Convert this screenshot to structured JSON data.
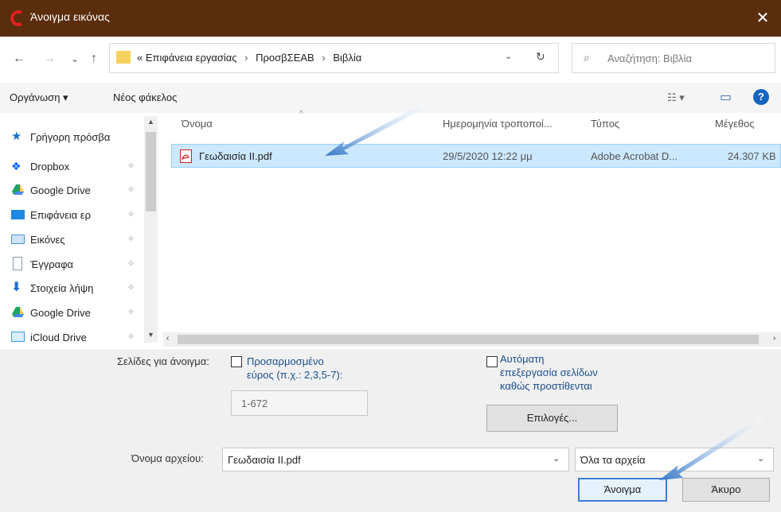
{
  "window": {
    "title": "Άνοιγμα εικόνας",
    "close_glyph": "✕"
  },
  "nav": {
    "back": "←",
    "forward": "→",
    "recent": "⌄",
    "up": "↑",
    "breadcrumb_prefix": "«",
    "breadcrumbs": [
      "Επιφάνεια εργασίας",
      "ΠροσβΣΕΑΒ",
      "Βιβλία"
    ],
    "separator": "›",
    "dropdown": "⌄",
    "refresh": "↻"
  },
  "search": {
    "placeholder": "Αναζήτηση: Βιβλία"
  },
  "toolbar": {
    "organize": "Οργάνωση ▾",
    "new_folder": "Νέος φάκελος",
    "view": "☷ ▾",
    "pane": "▭",
    "help": "?"
  },
  "sidebar": {
    "items": [
      {
        "label": "Γρήγορη πρόσβα",
        "icon": "star-icon",
        "color": "#1a73c8",
        "pinned": false
      },
      {
        "label": "Dropbox",
        "icon": "dropbox-icon",
        "color": "#0061fe",
        "pinned": true
      },
      {
        "label": "Google Drive",
        "icon": "google-drive-icon",
        "color": "#1fa463",
        "pinned": true
      },
      {
        "label": "Επιφάνεια ερ",
        "icon": "desktop-icon",
        "color": "#1e88e5",
        "pinned": true
      },
      {
        "label": "Εικόνες",
        "icon": "pictures-icon",
        "color": "#4a90d9",
        "pinned": true
      },
      {
        "label": "Έγγραφα",
        "icon": "documents-icon",
        "color": "#8899aa",
        "pinned": true
      },
      {
        "label": "Στοιχεία λήψη",
        "icon": "downloads-icon",
        "color": "#1e6fd0",
        "pinned": true
      },
      {
        "label": "Google Drive",
        "icon": "google-drive-icon",
        "color": "#1fa463",
        "pinned": true
      },
      {
        "label": "iCloud Drive",
        "icon": "icloud-icon",
        "color": "#3b9be0",
        "pinned": true
      }
    ],
    "pin_glyph": "✧"
  },
  "columns": {
    "name": "Όνομα",
    "date": "Ημερομηνία τροποποί...",
    "type": "Τύπος",
    "size": "Μέγεθος"
  },
  "files": [
    {
      "name": "Γεωδαισία ΙΙ.pdf",
      "date": "29/5/2020 12:22 μμ",
      "type": "Adobe Acrobat D...",
      "size": "24.307 KB"
    }
  ],
  "options": {
    "pages_label": "Σελίδες για άνοιγμα:",
    "custom_range_label": "Προσαρμοσμένο",
    "custom_range_hint": "εύρος (π.χ.: 2,3,5-7):",
    "range_value": "1-672",
    "auto_process_label_1": "Αυτόματη",
    "auto_process_label_2": "επεξεργασία σελίδων",
    "auto_process_label_3": "καθώς προστίθενται",
    "options_button": "Επιλογές..."
  },
  "footer": {
    "filename_label": "Όνομα αρχείου:",
    "filename_value": "Γεωδαισία ΙΙ.pdf",
    "filter_value": "Όλα τα αρχεία",
    "open_button": "Άνοιγμα",
    "cancel_button": "Άκυρο"
  },
  "colors": {
    "titlebar": "#5a2d0c",
    "selection": "#cce8ff",
    "arrow": "#3a7bc8",
    "link": "#1a4f8e"
  }
}
